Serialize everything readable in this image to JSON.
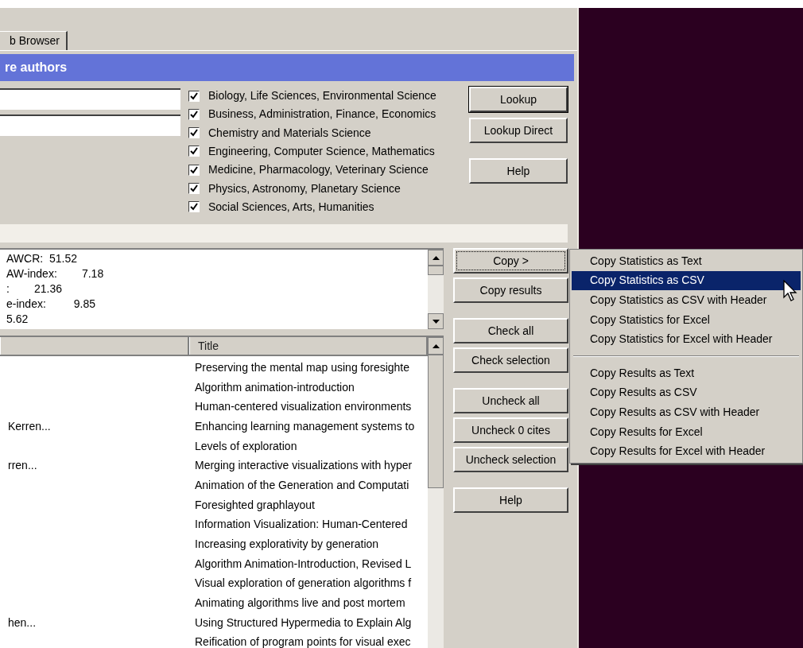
{
  "tab": {
    "label": "b Browser",
    "selected": true
  },
  "header": {
    "title": "re authors"
  },
  "subjects": [
    {
      "label": "Biology, Life Sciences, Environmental Science",
      "checked": true
    },
    {
      "label": "Business, Administration, Finance, Economics",
      "checked": true
    },
    {
      "label": "Chemistry and Materials Science",
      "checked": true
    },
    {
      "label": "Engineering, Computer Science, Mathematics",
      "checked": true
    },
    {
      "label": "Medicine, Pharmacology, Veterinary Science",
      "checked": true
    },
    {
      "label": "Physics, Astronomy, Planetary Science",
      "checked": true
    },
    {
      "label": "Social Sciences, Arts, Humanities",
      "checked": true
    }
  ],
  "lookup_buttons": [
    {
      "label": "Lookup",
      "default": true
    },
    {
      "label": "Lookup Direct",
      "default": false
    },
    {
      "label": "Help",
      "default": false
    }
  ],
  "statistics": [
    "AWCR:  51.52",
    "AW-index:        7.18",
    ":        21.36",
    "e-index:         9.85",
    "5.62"
  ],
  "table": {
    "columns": [
      "",
      "Title"
    ],
    "rows": [
      [
        "",
        "Preserving the mental map using foresighte"
      ],
      [
        "",
        "Algorithm animation-introduction"
      ],
      [
        "",
        "Human-centered visualization environments"
      ],
      [
        "Kerren...",
        "Enhancing learning management systems to"
      ],
      [
        "",
        "Levels of exploration"
      ],
      [
        "rren...",
        "Merging interactive visualizations with hyper"
      ],
      [
        "",
        "Animation of the Generation and Computati"
      ],
      [
        "",
        "Foresighted graphlayout"
      ],
      [
        "",
        "Information Visualization: Human-Centered"
      ],
      [
        "",
        "Increasing explorativity by generation"
      ],
      [
        "",
        "Algorithm Animation-Introduction, Revised L"
      ],
      [
        "",
        "Visual exploration of generation algorithms f"
      ],
      [
        "",
        "Animating algorithms live and post mortem"
      ],
      [
        "hen...",
        "Using Structured Hypermedia to Explain Alg"
      ],
      [
        "",
        "Reification of program points for visual exec"
      ]
    ]
  },
  "action_button_groups": [
    [
      {
        "label": "Copy >",
        "focused": true
      },
      {
        "label": "Copy results",
        "focused": false
      }
    ],
    [
      {
        "label": "Check all",
        "focused": false
      },
      {
        "label": "Check selection",
        "focused": false
      }
    ],
    [
      {
        "label": "Uncheck all",
        "focused": false
      },
      {
        "label": "Uncheck 0 cites",
        "focused": false
      },
      {
        "label": "Uncheck selection",
        "focused": false
      }
    ],
    [
      {
        "label": "Help",
        "focused": false
      }
    ]
  ],
  "copy_menu": [
    {
      "kind": "item",
      "label": "Copy Statistics as Text",
      "selected": false
    },
    {
      "kind": "item",
      "label": "Copy Statistics as CSV",
      "selected": true
    },
    {
      "kind": "item",
      "label": "Copy Statistics as CSV with Header",
      "selected": false
    },
    {
      "kind": "item",
      "label": "Copy Statistics for Excel",
      "selected": false
    },
    {
      "kind": "item",
      "label": "Copy Statistics for Excel with Header",
      "selected": false
    },
    {
      "kind": "separator"
    },
    {
      "kind": "item",
      "label": "Copy Results as Text",
      "selected": false
    },
    {
      "kind": "item",
      "label": "Copy Results as CSV",
      "selected": false
    },
    {
      "kind": "item",
      "label": "Copy Results as CSV with Header",
      "selected": false
    },
    {
      "kind": "item",
      "label": "Copy Results for Excel",
      "selected": false
    },
    {
      "kind": "item",
      "label": "Copy Results for Excel with Header",
      "selected": false
    }
  ]
}
